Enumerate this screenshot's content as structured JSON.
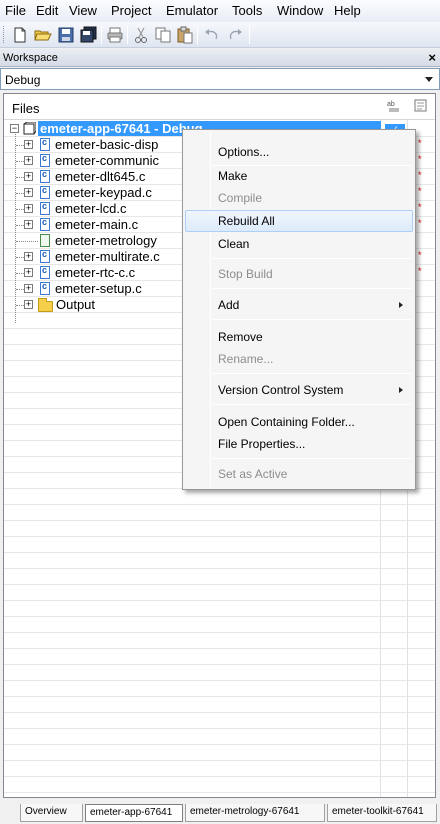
{
  "menubar": {
    "items": [
      "File",
      "Edit",
      "View",
      "Project",
      "Emulator",
      "Tools",
      "Window",
      "Help"
    ]
  },
  "toolbar": {
    "buttons": [
      "new-file-icon",
      "open-folder-icon",
      "save-icon",
      "save-all-icon",
      "print-icon",
      "cut-icon",
      "copy-icon",
      "paste-icon",
      "undo-icon",
      "redo-icon"
    ]
  },
  "workspace": {
    "title": "Workspace",
    "close": "×",
    "configuration": "Debug"
  },
  "tree": {
    "header": "Files",
    "project": "emeter-app-67641 - Debug",
    "files": [
      "emeter-basic-disp",
      "emeter-communic",
      "emeter-dlt645.c",
      "emeter-keypad.c",
      "emeter-lcd.c",
      "emeter-main.c",
      "emeter-metrology",
      "emeter-multirate.c",
      "emeter-rtc-c.c",
      "emeter-setup.c",
      "Output"
    ],
    "marks": [
      "*",
      "*",
      "*",
      "*",
      "*",
      "*",
      "*",
      "*"
    ]
  },
  "context_menu": {
    "options": "Options...",
    "make": "Make",
    "compile": "Compile",
    "rebuild_all": "Rebuild All",
    "clean": "Clean",
    "stop_build": "Stop Build",
    "add": "Add",
    "remove": "Remove",
    "rename": "Rename...",
    "vcs": "Version Control System",
    "open_folder": "Open Containing Folder...",
    "file_properties": "File Properties...",
    "set_active": "Set as Active"
  },
  "tabs": [
    "Overview",
    "emeter-app-67641",
    "emeter-metrology-67641",
    "emeter-toolkit-67641"
  ],
  "colors": {
    "selection": "#3399ff",
    "menu_highlight": "#dceafa",
    "error_mark": "#d00000"
  }
}
